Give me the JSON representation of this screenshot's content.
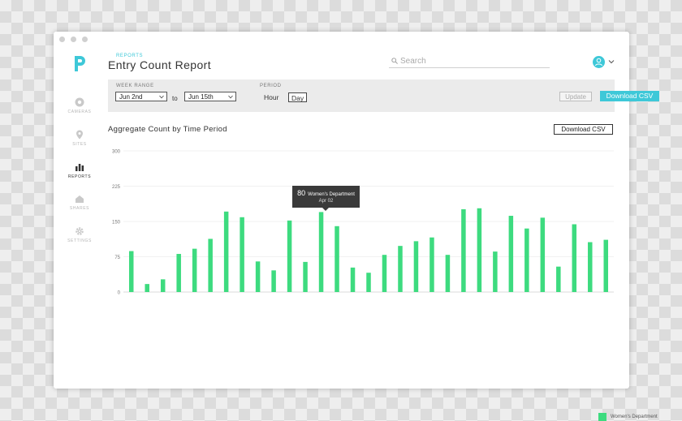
{
  "app": {
    "brand_color": "#3ec8d8",
    "bar_color": "#3ddb7f"
  },
  "sidebar": {
    "logo_icon": "p-logo-icon",
    "items": [
      {
        "label": "CAMERAS",
        "icon": "camera-icon"
      },
      {
        "label": "SITES",
        "icon": "map-pin-icon"
      },
      {
        "label": "REPORTS",
        "icon": "bar-chart-icon",
        "active": true
      },
      {
        "label": "SHARES",
        "icon": "share-icon"
      },
      {
        "label": "SETTINGS",
        "icon": "gear-icon"
      }
    ]
  },
  "header": {
    "breadcrumb": "REPORTS",
    "title": "Entry Count Report",
    "search_placeholder": "Search",
    "search_icon": "search-icon",
    "avatar_icon": "user-icon"
  },
  "filters": {
    "week_range_label": "WEEK RANGE",
    "from_value": "Jun 2nd",
    "to_label": "to",
    "to_value": "Jun 15th",
    "period_label": "PERIOD",
    "period_options": [
      "Hour",
      "Day"
    ],
    "period_selected": "Day",
    "update_label": "Update",
    "download_label": "Download CSV"
  },
  "section": {
    "title": "Aggregate Count by Time Period",
    "download_label": "Download CSV"
  },
  "chart_data": {
    "type": "bar",
    "title": "",
    "xlabel": "",
    "ylabel": "",
    "ylim": [
      0,
      300
    ],
    "yticks": [
      0,
      75,
      150,
      225,
      300
    ],
    "grid": true,
    "legend": "bottom-right",
    "series": [
      {
        "name": "Women's Department",
        "values": [
          87,
          17,
          27,
          81,
          92,
          113,
          171,
          159,
          65,
          46,
          152,
          64,
          170,
          140,
          52,
          41,
          79,
          98,
          108,
          116,
          79,
          176,
          178,
          86,
          162,
          135,
          158,
          54,
          144,
          106,
          111
        ]
      }
    ],
    "tooltip": {
      "value": "80",
      "series": "Women's Department",
      "date": "Apr 02"
    }
  }
}
